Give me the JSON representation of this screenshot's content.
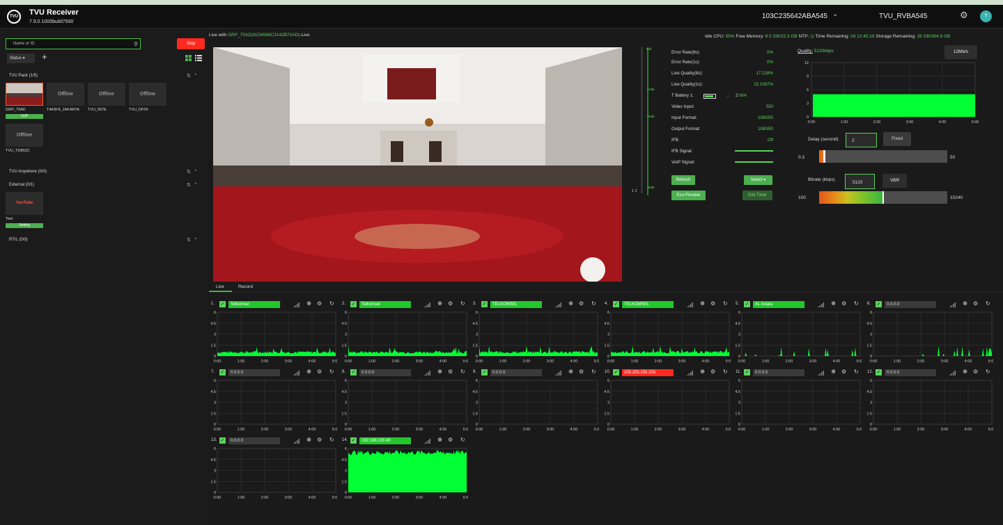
{
  "header": {
    "logo_text": "TVU",
    "app_title": "TVU Receiver",
    "version": "7.9.0.1000build7930",
    "device_id": "103C235642ABA545",
    "user_name": "TVU_RVBA545",
    "avatar_letter": "T"
  },
  "sidebar": {
    "search_placeholder": "Name or ID",
    "stop_label": "Stop",
    "status_label": "Status ▾",
    "groups": [
      {
        "title": "TVU Pack (1/5)"
      },
      {
        "title": "TVU Anywhere (0/0)"
      },
      {
        "title": "External (0/1)"
      },
      {
        "title": "RTIL (0/0)"
      }
    ],
    "tiles": [
      {
        "name": "GRP_70AD",
        "text": "",
        "badge": "VoIP"
      },
      {
        "name": "T4A3F8_JAKARTA",
        "text": "Offline"
      },
      {
        "name": "TVU_567E",
        "text": "Offline"
      },
      {
        "name": "TVU_DF09",
        "text": "Offline"
      },
      {
        "name": "TVU_TDB52C",
        "text": "Offline"
      },
      {
        "name": "Test",
        "text": "YouTube",
        "badge": "Setting"
      }
    ]
  },
  "live_with": {
    "prefix": "Live with",
    "source": "GRP_70AD(9234586C3142B70AD)",
    "suffix": "-Live"
  },
  "sysinfo": {
    "cpu_label": "Idle CPU:",
    "cpu": "55%",
    "mem_label": "Free Memory:",
    "mem": "6.5 GB/15.3 GB",
    "ntp_label": "NTP:",
    "time_label": "Time Remaining:",
    "time": "0d 12:45:19",
    "storage_label": "Storage Remaining:",
    "storage": "28 GB/364.9 GB"
  },
  "vu": {
    "labels": [
      "0db",
      "-10db",
      "-20db",
      "-40db"
    ],
    "channels": "1 2"
  },
  "stats": [
    {
      "label": "Error Rate(8s):",
      "value": "0%"
    },
    {
      "label": "Error Rate(1s):",
      "value": "0%"
    },
    {
      "label": "Line Quality(8s):",
      "value": "17.228%"
    },
    {
      "label": "Line Quality(1s):",
      "value": "15.1067%"
    },
    {
      "label": "T Battery 1:",
      "value": "N/A",
      "extra": "2:"
    },
    {
      "label": "Video Input:",
      "value": "SDI"
    },
    {
      "label": "Input Format:",
      "value": "1080i50"
    },
    {
      "label": "Output Format:",
      "value": "1080i50"
    },
    {
      "label": "IFB:",
      "value": "Off"
    },
    {
      "label": "IFB Signal:",
      "value": ""
    },
    {
      "label": "VoIP Signal:",
      "value": ""
    }
  ],
  "buttons": {
    "refresh": "Refresh",
    "select": "Select ▾",
    "eco": "Eco-Preview",
    "edit_timer": "Edit Timer"
  },
  "quality": {
    "label": "Quality:",
    "value": "5120kbps",
    "rate_btn": "12Mb/s",
    "chart": {
      "type": "area",
      "x_ticks": [
        "0:00",
        "1:00",
        "2:00",
        "3:00",
        "4:00",
        "5:00"
      ],
      "y_ticks": [
        "0",
        "3",
        "6",
        "9",
        "12"
      ],
      "ylim": [
        0,
        12
      ],
      "level": 5
    }
  },
  "delay": {
    "label": "Delay (second)",
    "value": "2",
    "mode": "Fixed",
    "min": "0.3",
    "max": "50",
    "numeric": 2
  },
  "bitrate": {
    "label": "Bitrate (kbps)",
    "value": "5120",
    "mode": "VBR",
    "min": "100",
    "max": "10240",
    "numeric": 5120
  },
  "tabs": {
    "live": "Live",
    "record": "Record"
  },
  "chart_data": [
    {
      "type": "area",
      "name": "1.",
      "label": "Telkomsel",
      "active": true,
      "x_ticks": [
        "0:00",
        "1:00",
        "2:00",
        "3:00",
        "4:00",
        "5:00"
      ],
      "y_ticks": [
        "0",
        "1.5",
        "3",
        "4.5",
        "6"
      ],
      "ylim": [
        0,
        6
      ],
      "profile": "low",
      "icons": [
        "signal-icon",
        "satellite-icon",
        "gear-icon",
        "refresh-icon"
      ]
    },
    {
      "type": "area",
      "name": "2.",
      "label": "Telkomsel",
      "active": true,
      "x_ticks": [
        "0:00",
        "1:00",
        "2:00",
        "3:00",
        "4:00",
        "5:00"
      ],
      "y_ticks": [
        "0",
        "1.5",
        "3",
        "4.5",
        "6"
      ],
      "ylim": [
        0,
        6
      ],
      "profile": "low"
    },
    {
      "type": "area",
      "name": "3.",
      "label": "TELKOMSEL",
      "active": true,
      "x_ticks": [
        "0:00",
        "1:00",
        "2:00",
        "3:00",
        "4:00",
        "5:00"
      ],
      "y_ticks": [
        "0",
        "1.5",
        "3",
        "4.5",
        "6"
      ],
      "ylim": [
        0,
        6
      ],
      "profile": "low"
    },
    {
      "type": "area",
      "name": "4.",
      "label": "TELKOMSEL",
      "active": true,
      "x_ticks": [
        "0:00",
        "1:00",
        "2:00",
        "3:00",
        "4:00",
        "5:00"
      ],
      "y_ticks": [
        "0",
        "1.5",
        "3",
        "4.5",
        "6"
      ],
      "ylim": [
        0,
        6
      ],
      "profile": "low"
    },
    {
      "type": "area",
      "name": "5.",
      "label": "XL Axiata",
      "active": true,
      "x_ticks": [
        "0:00",
        "1:00",
        "2:00",
        "3:00",
        "4:00",
        "5:00"
      ],
      "y_ticks": [
        "0",
        "1.5",
        "3",
        "4.5",
        "6"
      ],
      "ylim": [
        0,
        6
      ],
      "profile": "sparse"
    },
    {
      "type": "area",
      "name": "6.",
      "label": "0.0.0.0",
      "active": false,
      "x_ticks": [
        "0:00",
        "1:00",
        "2:00",
        "3:00",
        "4:00",
        "5:00"
      ],
      "y_ticks": [
        "0",
        "1.5",
        "3",
        "4.5",
        "6"
      ],
      "ylim": [
        0,
        6
      ],
      "profile": "spikes"
    },
    {
      "type": "area",
      "name": "7.",
      "label": "0.0.0.0",
      "active": false,
      "x_ticks": [
        "0:00",
        "1:00",
        "2:00",
        "3:00",
        "4:00",
        "5:00"
      ],
      "y_ticks": [
        "0",
        "1.5",
        "3",
        "4.5",
        "6"
      ],
      "ylim": [
        0,
        6
      ],
      "profile": "none"
    },
    {
      "type": "area",
      "name": "8.",
      "label": "0.0.0.0",
      "active": false,
      "x_ticks": [
        "0:00",
        "1:00",
        "2:00",
        "3:00",
        "4:00",
        "5:00"
      ],
      "y_ticks": [
        "0",
        "1.5",
        "3",
        "4.5",
        "6"
      ],
      "ylim": [
        0,
        6
      ],
      "profile": "none"
    },
    {
      "type": "area",
      "name": "9.",
      "label": "0.0.0.0",
      "active": false,
      "x_ticks": [
        "0:00",
        "1:00",
        "2:00",
        "3:00",
        "4:00",
        "5:00"
      ],
      "y_ticks": [
        "0",
        "1.5",
        "3",
        "4.5",
        "6"
      ],
      "ylim": [
        0,
        6
      ],
      "profile": "none"
    },
    {
      "type": "area",
      "name": "10.",
      "label": "255.255.255.255",
      "active": "error",
      "x_ticks": [
        "0:00",
        "1:00",
        "2:00",
        "3:00",
        "4:00",
        "5:00"
      ],
      "y_ticks": [
        "0",
        "1.5",
        "3",
        "4.5",
        "6"
      ],
      "ylim": [
        0,
        6
      ],
      "profile": "none"
    },
    {
      "type": "area",
      "name": "11.",
      "label": "0.0.0.0",
      "active": false,
      "x_ticks": [
        "0:00",
        "1:00",
        "2:00",
        "3:00",
        "4:00",
        "5:00"
      ],
      "y_ticks": [
        "0",
        "1.5",
        "3",
        "4.5",
        "6"
      ],
      "ylim": [
        0,
        6
      ],
      "profile": "none"
    },
    {
      "type": "area",
      "name": "12.",
      "label": "0.0.0.0",
      "active": false,
      "x_ticks": [
        "0:00",
        "1:00",
        "2:00",
        "3:00",
        "4:00",
        "5:00"
      ],
      "y_ticks": [
        "0",
        "1.5",
        "3",
        "4.5",
        "6"
      ],
      "ylim": [
        0,
        6
      ],
      "profile": "none"
    },
    {
      "type": "area",
      "name": "13.",
      "label": "0.0.0.0",
      "active": false,
      "x_ticks": [
        "0:00",
        "1:00",
        "2:00",
        "3:00",
        "4:00",
        "5:00"
      ],
      "y_ticks": [
        "0",
        "1.5",
        "3",
        "4.5",
        "6"
      ],
      "ylim": [
        0,
        6
      ],
      "profile": "none"
    },
    {
      "type": "area",
      "name": "14.",
      "label": "192.168.100.40",
      "active": true,
      "x_ticks": [
        "0:00",
        "1:00",
        "2:00",
        "3:00",
        "4:00",
        "5:00"
      ],
      "y_ticks": [
        "0",
        "1.5",
        "3",
        "4.5",
        "6"
      ],
      "ylim": [
        0,
        6
      ],
      "profile": "full"
    }
  ]
}
